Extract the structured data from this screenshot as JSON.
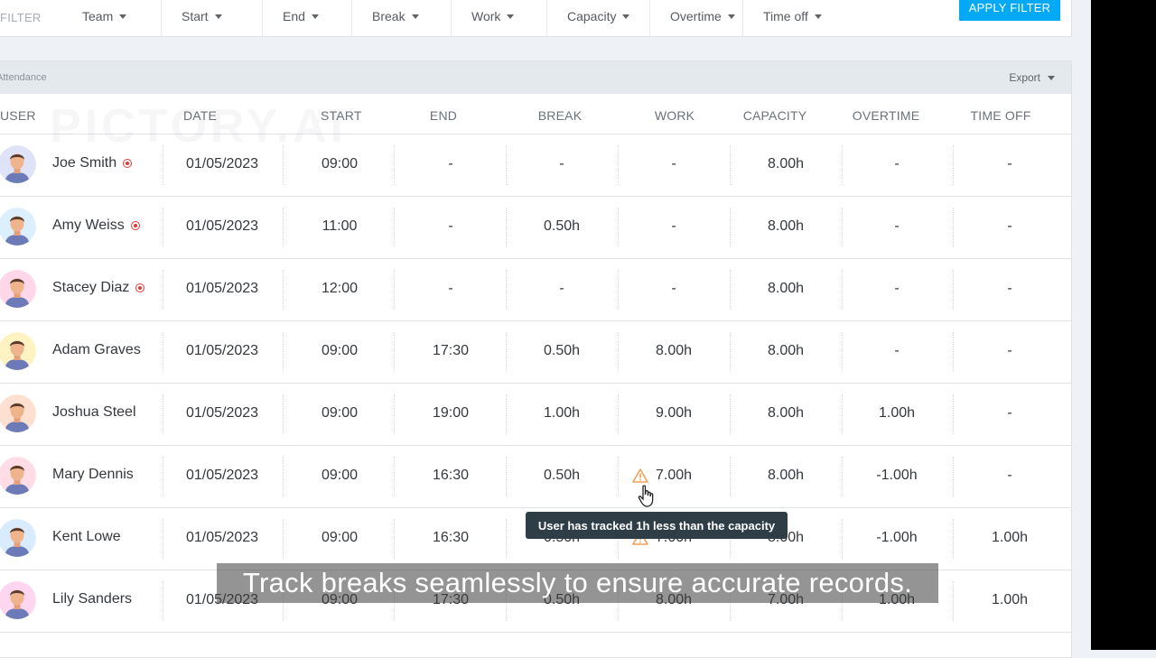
{
  "filter": {
    "label": "FILTER",
    "items": [
      "Team",
      "Start",
      "End",
      "Break",
      "Work",
      "Capacity",
      "Overtime",
      "Time off"
    ],
    "apply_label": "APPLY FILTER",
    "accent": "#03a9f4"
  },
  "panel": {
    "title": "Attendance",
    "export_label": "Export"
  },
  "columns": [
    "USER",
    "DATE",
    "START",
    "END",
    "BREAK",
    "WORK",
    "CAPACITY",
    "OVERTIME",
    "TIME OFF"
  ],
  "rows": [
    {
      "user": "Joe Smith",
      "recording": true,
      "date": "01/05/2023",
      "start": "09:00",
      "end": "-",
      "break": "-",
      "work": "-",
      "capacity": "8.00h",
      "overtime": "-",
      "timeoff": "-",
      "avatar_bg": "#dfe3f7"
    },
    {
      "user": "Amy Weiss",
      "recording": true,
      "date": "01/05/2023",
      "start": "11:00",
      "end": "-",
      "break": "0.50h",
      "work": "-",
      "capacity": "8.00h",
      "overtime": "-",
      "timeoff": "-",
      "avatar_bg": "#dcefff"
    },
    {
      "user": "Stacey Diaz",
      "recording": true,
      "date": "01/05/2023",
      "start": "12:00",
      "end": "-",
      "break": "-",
      "work": "-",
      "capacity": "8.00h",
      "overtime": "-",
      "timeoff": "-",
      "avatar_bg": "#ffd7e8"
    },
    {
      "user": "Adam Graves",
      "recording": false,
      "date": "01/05/2023",
      "start": "09:00",
      "end": "17:30",
      "break": "0.50h",
      "work": "8.00h",
      "capacity": "8.00h",
      "overtime": "-",
      "timeoff": "-",
      "avatar_bg": "#fff3c4"
    },
    {
      "user": "Joshua Steel",
      "recording": false,
      "date": "01/05/2023",
      "start": "09:00",
      "end": "19:00",
      "break": "1.00h",
      "work": "9.00h",
      "capacity": "8.00h",
      "overtime": "1.00h",
      "timeoff": "-",
      "avatar_bg": "#ffe0d0"
    },
    {
      "user": "Mary Dennis",
      "recording": false,
      "date": "01/05/2023",
      "start": "09:00",
      "end": "16:30",
      "break": "0.50h",
      "work": "7.00h",
      "capacity": "8.00h",
      "overtime": "-1.00h",
      "timeoff": "-",
      "avatar_bg": "#ffdce6"
    },
    {
      "user": "Kent Lowe",
      "recording": false,
      "date": "01/05/2023",
      "start": "09:00",
      "end": "16:30",
      "break": "0.50h",
      "work": "7.00h",
      "capacity": "8.00h",
      "overtime": "-1.00h",
      "timeoff": "1.00h",
      "avatar_bg": "#d9ecff"
    },
    {
      "user": "Lily Sanders",
      "recording": false,
      "date": "01/05/2023",
      "start": "09:00",
      "end": "17:30",
      "break": "0.50h",
      "work": "8.00h",
      "capacity": "7.00h",
      "overtime": "1.00h",
      "timeoff": "1.00h",
      "avatar_bg": "#ffd6ef"
    }
  ],
  "tooltip": "User has tracked 1h less than the capacity",
  "caption": "Track breaks seamlessly to ensure accurate records.",
  "watermark": "PICTORY.AI",
  "icons": {
    "warning": "warning-icon",
    "cursor": "hand-cursor-icon",
    "export": "chevron-down-icon",
    "recording": "recording-icon"
  }
}
